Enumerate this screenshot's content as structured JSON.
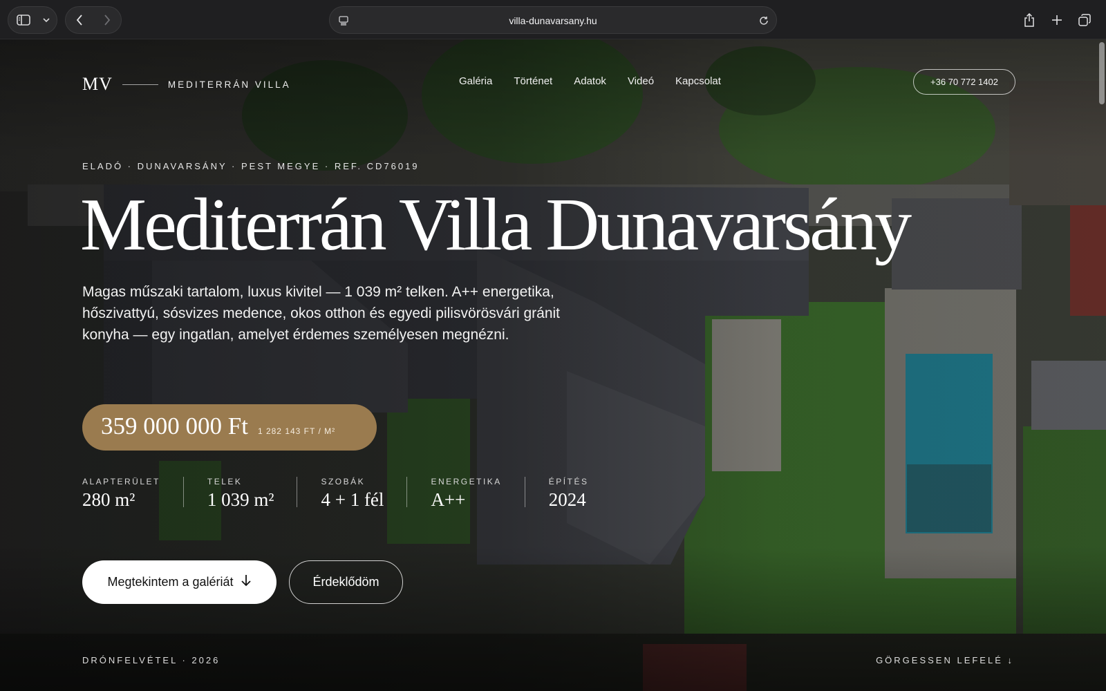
{
  "browser": {
    "url": "villa-dunavarsany.hu"
  },
  "site": {
    "brand_mark": "MV",
    "brand_name": "MEDITERRÁN VILLA",
    "nav": [
      "Galéria",
      "Történet",
      "Adatok",
      "Videó",
      "Kapcsolat"
    ],
    "phone": "+36 70 772 1402"
  },
  "hero": {
    "eyebrow": "ELADÓ · DUNAVARSÁNY · PEST MEGYE · REF. CD76019",
    "title": "Mediterrán Villa Dunavarsány",
    "lede": "Magas műszaki tartalom, luxus kivitel — 1 039 m² telken. A++ energetika, hőszivattyú, sósvizes medence, okos otthon és egyedi pilisvörösvári gránit konyha — egy ingatlan, amelyet érdemes személyesen megnézni.",
    "price": "359 000 000 Ft",
    "price_per_sqm": "1 282 143 FT / M²",
    "stats": [
      {
        "label": "ALAPTERÜLET",
        "value": "280 m²"
      },
      {
        "label": "TELEK",
        "value": "1 039 m²"
      },
      {
        "label": "SZOBÁK",
        "value": "4 + 1 fél"
      },
      {
        "label": "ENERGETIKA",
        "value": "A++"
      },
      {
        "label": "ÉPÍTÉS",
        "value": "2024"
      }
    ],
    "primary_cta": "Megtekintem a galériát",
    "secondary_cta": "Érdeklődöm",
    "footer_left": "DRÓNFELVÉTEL · 2026",
    "footer_right": "GÖRGESSEN LEFELÉ ↓"
  },
  "colors": {
    "accent": "#9a7b4f",
    "chrome": "#1f1f21"
  }
}
